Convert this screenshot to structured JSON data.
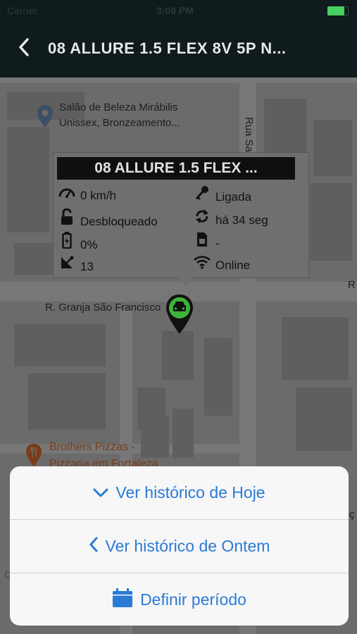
{
  "status_bar": {
    "carrier": "Carrier",
    "time": "3:09 PM"
  },
  "navbar": {
    "back_icon": "chevron-left-icon",
    "title": "08 ALLURE 1.5 FLEX 8V 5P N..."
  },
  "map": {
    "poi_salon_line1": "Salão de Beleza Mirábilis",
    "poi_salon_line2": "Unissex, Bronzeamento...",
    "street_rua": "Rua Sa",
    "street_granja": "R. Granja São Francisco",
    "poi_pizza_line1": "Brothers Pizzas -",
    "poi_pizza_line2": "Pizzaria em Fortaleza",
    "edge_r": "R",
    "edge_c": "ç",
    "edge_o": "C"
  },
  "vehicle_callout": {
    "title": "08 ALLURE 1.5 FLEX ...",
    "speed": "0 km/h",
    "ignition": "Ligada",
    "lock_status": "Desbloqueado",
    "last_update": "há 34 seg",
    "battery": "0%",
    "sim": "-",
    "satellites": "13",
    "connection": "Online"
  },
  "action_sheet": {
    "today": "Ver histórico de Hoje",
    "yesterday": "Ver histórico de Ontem",
    "period": "Definir período"
  },
  "colors": {
    "accent": "#2a7bd6",
    "marker": "#3db33a",
    "navbar": "#0f1b1d"
  }
}
